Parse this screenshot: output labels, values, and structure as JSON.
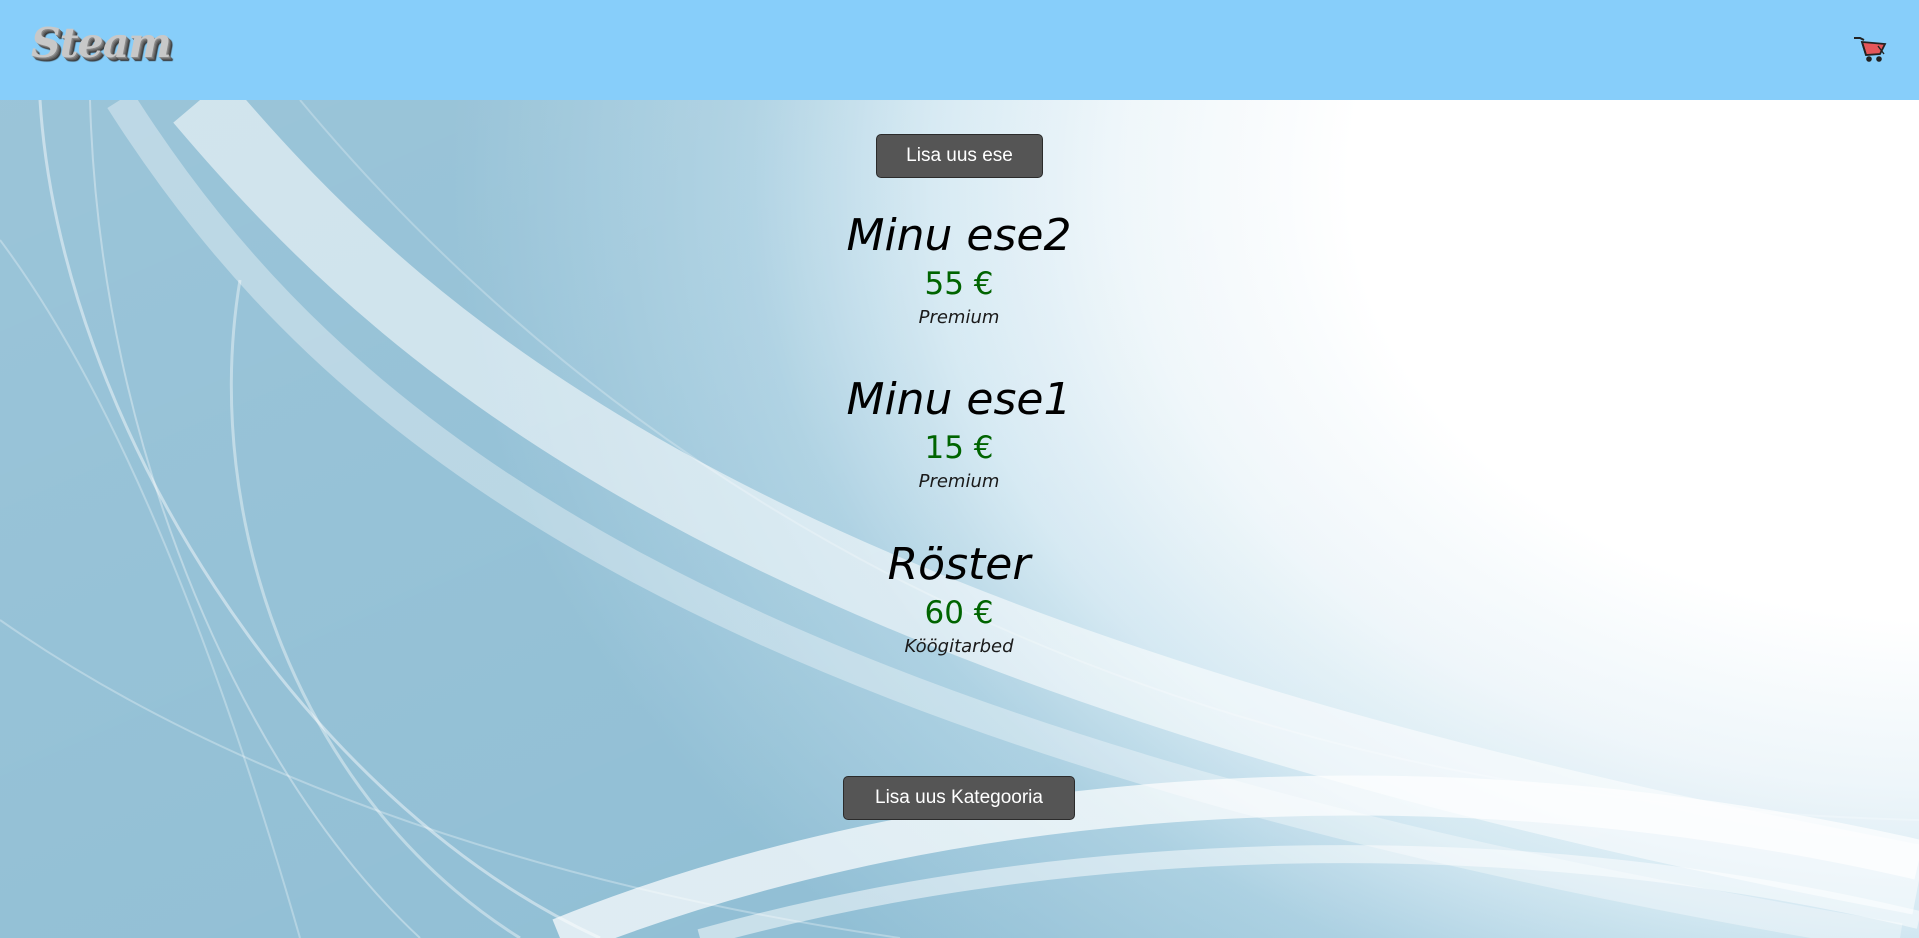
{
  "header": {
    "brand": "Steam",
    "cart_icon": "cart-icon"
  },
  "main": {
    "add_item_label": "Lisa uus ese",
    "add_category_label": "Lisa uus Kategooria",
    "items": [
      {
        "name": "Minu ese2",
        "price": "55 €",
        "category": "Premium"
      },
      {
        "name": "Minu ese1",
        "price": "15 €",
        "category": "Premium"
      },
      {
        "name": "Röster",
        "price": "60 €",
        "category": "Köögitarbed"
      }
    ]
  },
  "colors": {
    "header_bg": "#87cefa",
    "button_bg": "#555555",
    "price": "#006400"
  }
}
